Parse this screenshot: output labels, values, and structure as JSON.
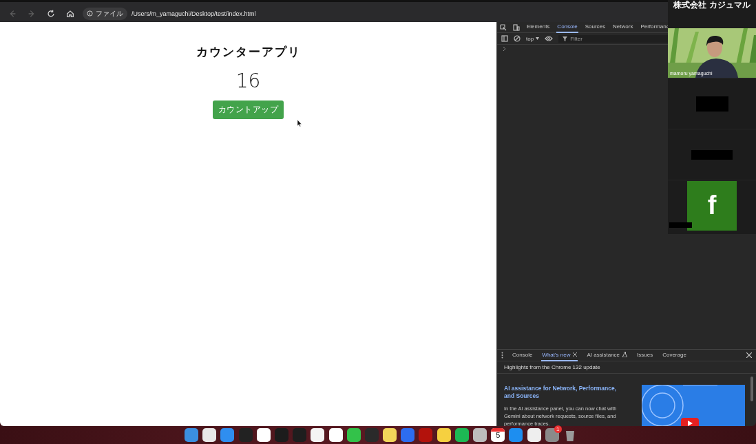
{
  "browser": {
    "nav": [
      {
        "kind": "back",
        "disabled": true
      },
      {
        "kind": "forward",
        "disabled": true
      },
      {
        "kind": "reload",
        "disabled": false
      },
      {
        "kind": "home",
        "disabled": false
      }
    ],
    "address": {
      "scheme": "ファイル",
      "url": "/Users/m_yamaguchi/Desktop/test/index.html"
    }
  },
  "page": {
    "title": "カウンターアプリ",
    "count": "16",
    "button": "カウントアップ"
  },
  "devtools": {
    "tabs": [
      {
        "label": "Elements",
        "selected": false
      },
      {
        "label": "Console",
        "selected": true
      },
      {
        "label": "Sources",
        "selected": false
      },
      {
        "label": "Network",
        "selected": false
      },
      {
        "label": "Performanc",
        "selected": false
      }
    ],
    "context": "top",
    "filter_placeholder": "Filter",
    "drawer_tabs": [
      {
        "label": "Console",
        "kind": "plain",
        "selected": false
      },
      {
        "label": "What's new",
        "kind": "closable",
        "selected": true
      },
      {
        "label": "AI assistance",
        "kind": "experimental",
        "selected": false
      },
      {
        "label": "Issues",
        "kind": "plain",
        "selected": false
      },
      {
        "label": "Coverage",
        "kind": "plain",
        "selected": false
      }
    ],
    "banner": "Highlights from the Chrome 132 update",
    "article": {
      "heading": "AI assistance for Network, Performance, and Sources",
      "body": "In the AI assistance panel, you can now chat with Gemini about network requests, source files, and performance traces."
    }
  },
  "meeting": {
    "org": "株式会社 カジュマル",
    "participants": [
      {
        "kind": "video",
        "name": "mamoru yamaguchi"
      },
      {
        "kind": "redacted"
      },
      {
        "kind": "redacted"
      },
      {
        "kind": "avatar",
        "initial": "f"
      }
    ]
  },
  "dock": {
    "calendar_day": "5",
    "badge": "1"
  }
}
